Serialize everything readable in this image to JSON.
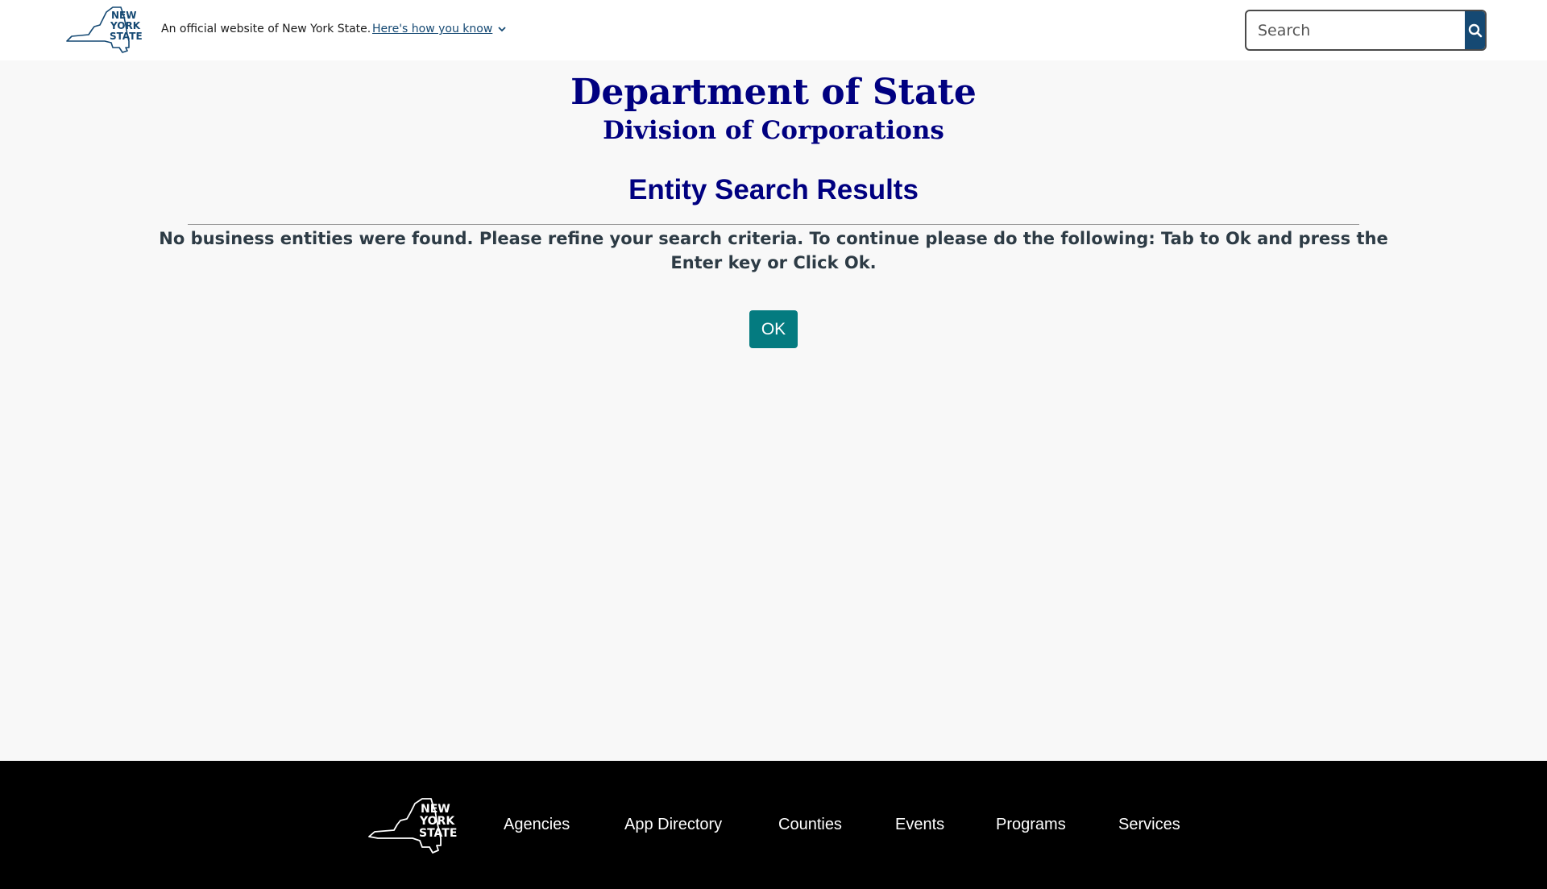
{
  "header": {
    "logo_lines": [
      "NEW",
      "YORK",
      "STATE"
    ],
    "official_text": "An official website of New York State.",
    "how_you_know_label": "Here's how you know",
    "search": {
      "placeholder": "Search",
      "value": ""
    }
  },
  "main": {
    "department_title": "Department of State",
    "division_title": "Division of Corporations",
    "results_title": "Entity Search Results",
    "message": "No business entities were found. Please refine your search criteria. To continue please do the following: Tab to Ok and press the Enter key or Click Ok.",
    "ok_label": "OK"
  },
  "footer": {
    "logo_lines": [
      "NEW",
      "YORK",
      "STATE"
    ],
    "links": [
      {
        "label": "Agencies"
      },
      {
        "label": "App Directory"
      },
      {
        "label": "Counties"
      },
      {
        "label": "Events"
      },
      {
        "label": "Programs"
      },
      {
        "label": "Services"
      }
    ]
  },
  "colors": {
    "navy_title": "#000080",
    "nys_blue": "#154973",
    "ok_teal": "#047b80",
    "message_text": "#2d3b45",
    "page_bg": "#f8f8f8",
    "footer_bg": "#000000"
  }
}
